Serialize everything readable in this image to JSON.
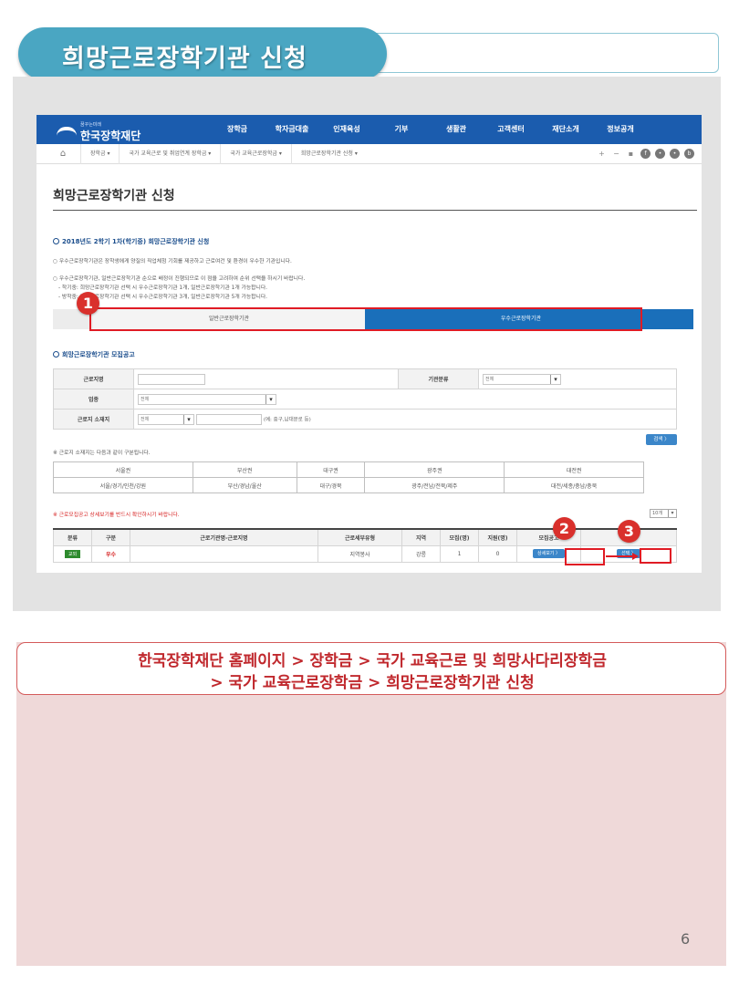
{
  "slide": {
    "title": "희망근로장학기관 신청",
    "path_line1": "한국장학재단 홈페이지 > 장학금 > 국가 교육근로 및 희망사다리장학금",
    "path_line2": "> 국가 교육근로장학금 > 희망근로장학기관 신청",
    "page_number": "6"
  },
  "site": {
    "logo_small": "꿈꾸는미래",
    "logo_text": "한국장학재단",
    "nav": [
      "장학금",
      "학자금대출",
      "인재육성",
      "기부",
      "생활관",
      "고객센터",
      "재단소개",
      "정보공개"
    ],
    "breadcrumbs": [
      "장학금 ▾",
      "국가 교육근로 및 취업연계 장학금 ▾",
      "국가 교육근로장학금 ▾",
      "희망근로장학기관 신청 ▾"
    ],
    "page_heading": "희망근로장학기관 신청",
    "notice_title": "2018년도 2학기 1차(학기중) 희망근로장학기관 신청",
    "notice_p1": "○ 우수근로장학기관은 장학생에게 양질의 직업체험 기회를 제공하고 근로여건 및 환경이 우수한 기관입니다.",
    "notice_p2": "○ 우수근로장학기관, 일반근로장학기관 순으로 배정이 진행되므로 이 점을 고려하여 순위 선택을 하시기 바랍니다.",
    "notice_p3": "- 학기중: 희망근로장학기관 선택 시 우수근로장학기관 1개, 일반근로장학기관 1개 가능합니다.",
    "notice_p4": "- 방학중: 희망근로장학기관 선택 시 우수근로장학기관 3개, 일반근로장학기관 5개 가능합니다.",
    "tab_general": "일반근로장학기관",
    "tab_excellent": "우수근로장학기관",
    "recruit_title": "희망근로장학기관 모집공고",
    "search": {
      "workplace_label": "근로지명",
      "org_class_label": "기관분류",
      "org_class_value": "전체",
      "industry_label": "업종",
      "industry_value": "전체",
      "location_label": "근로지 소재지",
      "location_value": "전체",
      "location_hint": "(예: 중구,남대문로 등)",
      "search_button": "검색 〉"
    },
    "region_note": "※ 근로지 소재지는 다음과 같이 구분됩니다.",
    "regions": {
      "headers": [
        "서울권",
        "부산권",
        "대구권",
        "광주권",
        "대전권"
      ],
      "values": [
        "서울/경기/인천/강원",
        "부산/경남/울산",
        "대구/경북",
        "광주/전남/전북/제주",
        "대전/세종/충남/충북"
      ]
    },
    "results_note": "※ 근로모집공고 상세보기를 반드시 확인하시기 바랍니다.",
    "per_page": "10개",
    "results": {
      "headers": [
        "분류",
        "구분",
        "근로기관명-근로지명",
        "근로세부유형",
        "지역",
        "모집(명)",
        "지원(명)",
        "모집공고",
        "참여"
      ],
      "row": {
        "type": "교외",
        "grade": "우수",
        "org_name": "",
        "detail_type": "지역봉사",
        "region": "강릉",
        "recruit": "1",
        "applied": "0",
        "detail_button": "상세보기 〉",
        "select_button": "선택 〉"
      }
    }
  },
  "annotations": {
    "step1": "1",
    "step2": "2",
    "step3": "3"
  },
  "colors": {
    "title_pill": "#4aa6c2",
    "site_nav": "#1b5cae",
    "highlight": "#e01b24",
    "path_text": "#c0282d",
    "path_panel": "#efd9d9"
  }
}
